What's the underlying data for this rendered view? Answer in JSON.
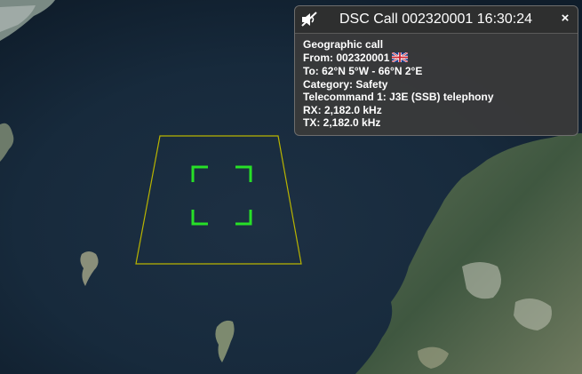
{
  "popup": {
    "title": "DSC Call 002320001 16:30:24",
    "mute_icon": "muted-speaker-icon",
    "close_icon": "close-icon",
    "close_label": "×",
    "call_type": "Geographic call",
    "from_label": "From: 002320001",
    "from_flag": "uk-flag-icon",
    "area": "To: 62°N 5°W - 66°N 2°E",
    "category": "Category: Safety",
    "telecommand": "Telecommand 1: J3E (SSB) telephony",
    "rx": "RX: 2,182.0 kHz",
    "tx": "TX: 2,182.0 kHz"
  },
  "map": {
    "area_outline_color": "#b9b400",
    "target_marker_color": "#27e027",
    "sea_color": "#16283a",
    "land_color": "#4a6147"
  }
}
